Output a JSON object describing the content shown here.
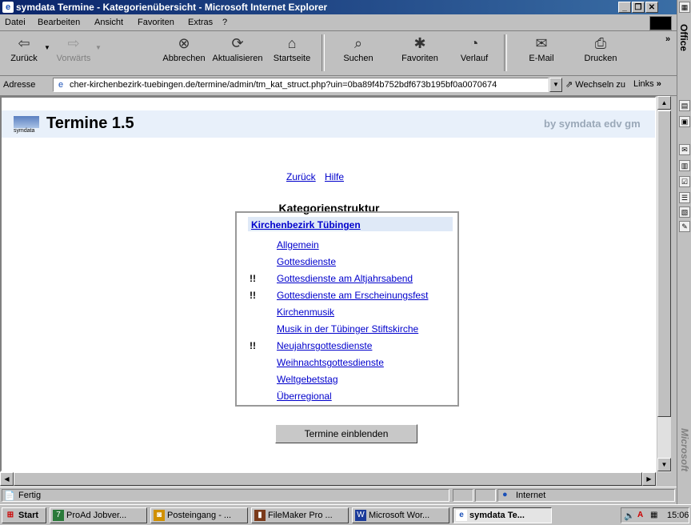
{
  "window": {
    "title": "symdata Termine - Kategorienübersicht - Microsoft Internet Explorer"
  },
  "menu": {
    "items": [
      "Datei",
      "Bearbeiten",
      "Ansicht",
      "Favoriten",
      "Extras",
      "?"
    ]
  },
  "toolbar": {
    "back": "Zurück",
    "forward": "Vorwärts",
    "stop": "Abbrechen",
    "refresh": "Aktualisieren",
    "home": "Startseite",
    "search": "Suchen",
    "favorites": "Favoriten",
    "history": "Verlauf",
    "mail": "E-Mail",
    "print": "Drucken"
  },
  "address": {
    "label": "Adresse",
    "url": "cher-kirchenbezirk-tuebingen.de/termine/admin/tm_kat_struct.php?uin=0ba89f4b752bdf673b195bf0a0070674",
    "go": "Wechseln zu",
    "links": "Links"
  },
  "office": {
    "label": "Office",
    "brand": "Microsoft"
  },
  "page": {
    "logo_text": "symdata",
    "app_title": "Termine 1.5",
    "byline": "by symdata edv gm",
    "nav": {
      "back": "Zurück",
      "help": "Hilfe"
    },
    "heading": "Kategorienstruktur",
    "root": "Kirchenbezirk Tübingen",
    "categories": [
      {
        "name": "Allgemein",
        "mark": ""
      },
      {
        "name": "Gottesdienste",
        "mark": ""
      },
      {
        "name": "Gottesdienste am Altjahrsabend",
        "mark": "!!"
      },
      {
        "name": "Gottesdienste am Erscheinungsfest",
        "mark": "!!"
      },
      {
        "name": "Kirchenmusik",
        "mark": ""
      },
      {
        "name": "Musik in der Tübinger Stiftskirche",
        "mark": ""
      },
      {
        "name": "Neujahrsgottesdienste",
        "mark": "!!"
      },
      {
        "name": "Weihnachtsgottesdienste",
        "mark": ""
      },
      {
        "name": "Weltgebetstag",
        "mark": ""
      },
      {
        "name": "Überregional",
        "mark": ""
      }
    ],
    "button": "Termine einblenden"
  },
  "status": {
    "text": "Fertig",
    "zone": "Internet"
  },
  "taskbar": {
    "start": "Start",
    "tasks": [
      "ProAd Jobver...",
      "Posteingang - ...",
      "FileMaker Pro ...",
      "Microsoft Wor...",
      "symdata Te..."
    ],
    "clock": "15:06"
  }
}
